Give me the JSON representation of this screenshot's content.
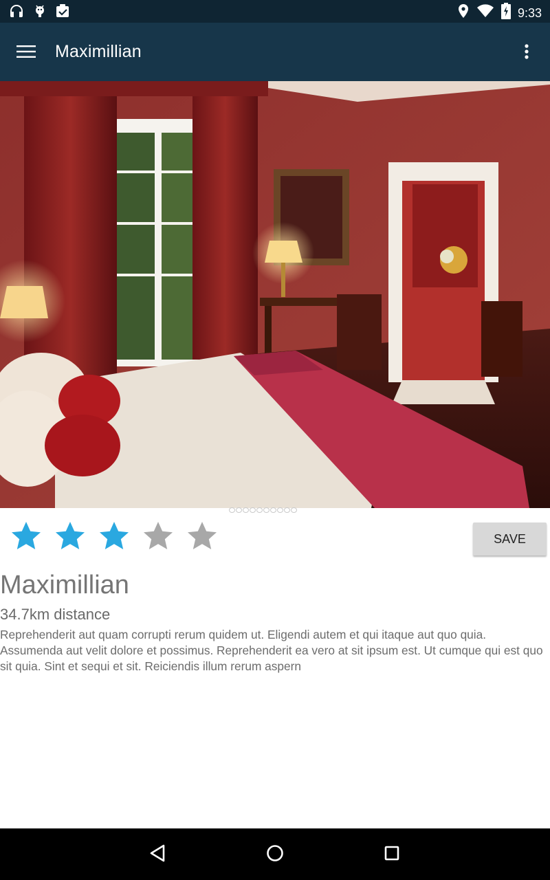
{
  "status_bar": {
    "time": "9:33",
    "left_icons": [
      "headset-icon",
      "android-debug-icon",
      "clipboard-check-icon"
    ],
    "right_icons": [
      "location-icon",
      "wifi-icon",
      "battery-charging-icon"
    ]
  },
  "app_bar": {
    "title": "Maximillian",
    "menu_icon": "hamburger-menu-icon",
    "overflow_icon": "more-vert-icon",
    "background": "#17364a"
  },
  "hero_image": {
    "description_label": "hotel room photo",
    "pager_count": 10,
    "pager_active": 0
  },
  "rating": {
    "value": 3,
    "max": 5,
    "filled_color": "#2aa8e0",
    "empty_color": "#a8a8a8"
  },
  "save_button": {
    "label": "SAVE"
  },
  "hotel": {
    "name": "Maximillian",
    "distance": "34.7km distance",
    "description": "Reprehenderit aut quam corrupti rerum quidem ut. Eligendi autem et qui itaque aut quo quia. Assumenda aut velit dolore et possimus. Reprehenderit ea vero at sit ipsum est. Ut cumque qui est quo sit quia. Sint et sequi et sit. Reiciendis illum rerum aspern"
  },
  "nav_bar": {
    "buttons": [
      "back-icon",
      "home-icon",
      "recents-icon"
    ]
  }
}
